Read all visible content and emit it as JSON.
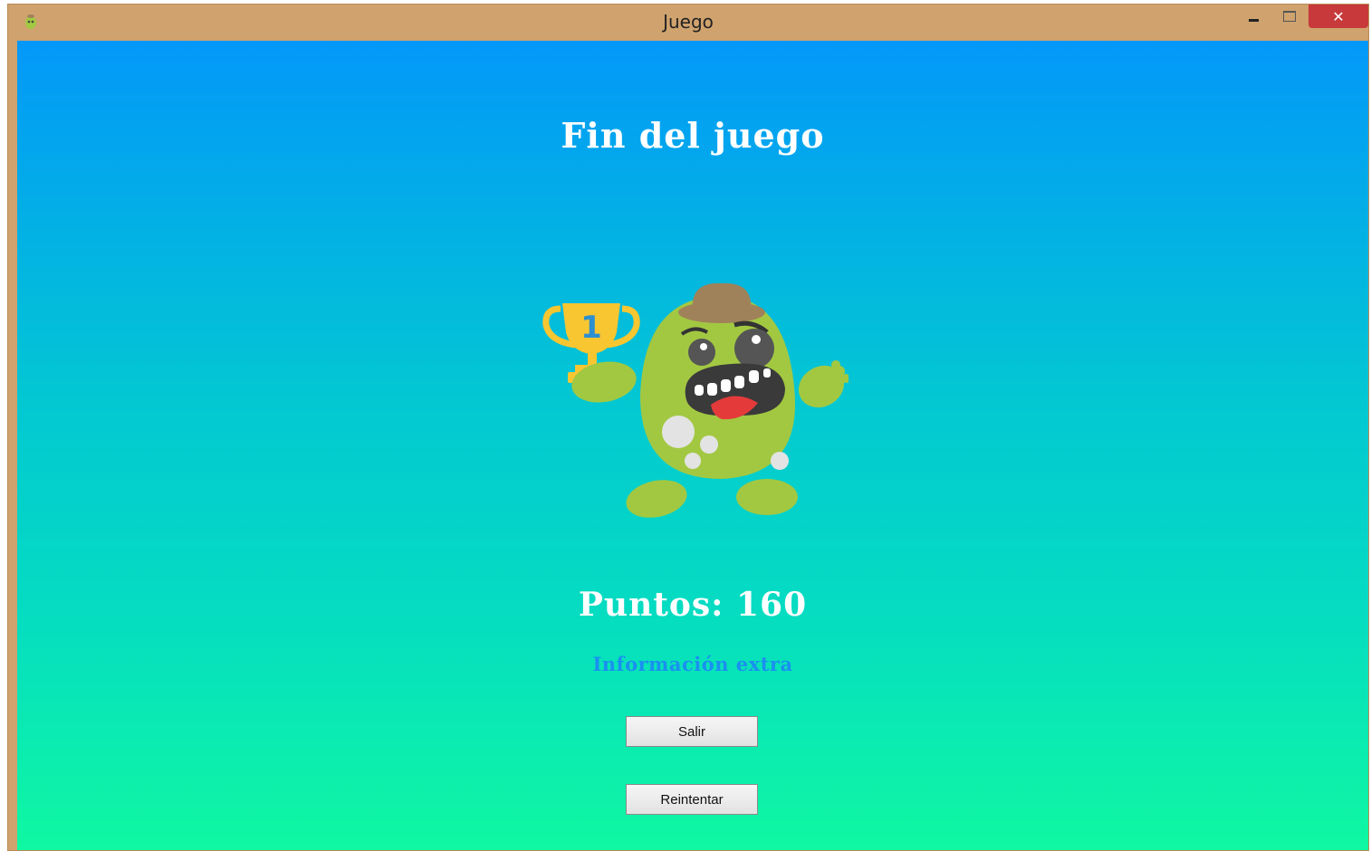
{
  "window": {
    "title": "Juego",
    "icons": {
      "app": "monster-app-icon",
      "minimize": "minimize-icon",
      "maximize": "maximize-icon",
      "close": "close-icon"
    },
    "close_glyph": "✕"
  },
  "screen": {
    "title": "Fin del juego",
    "score_text": "Puntos: 160",
    "extra_info": "Información extra",
    "image": "monster-with-trophy-icon",
    "trophy_number": "1"
  },
  "buttons": {
    "exit_label": "Salir",
    "retry_label": "Reintentar"
  },
  "colors": {
    "frame": "#cfa26e",
    "gradient_top": "#0398f9",
    "gradient_bottom": "#0ff8a2",
    "close_button": "#c7393a",
    "extra_info_text": "#1a90f0",
    "monster_green": "#a2c842",
    "trophy_gold": "#f8c630"
  }
}
